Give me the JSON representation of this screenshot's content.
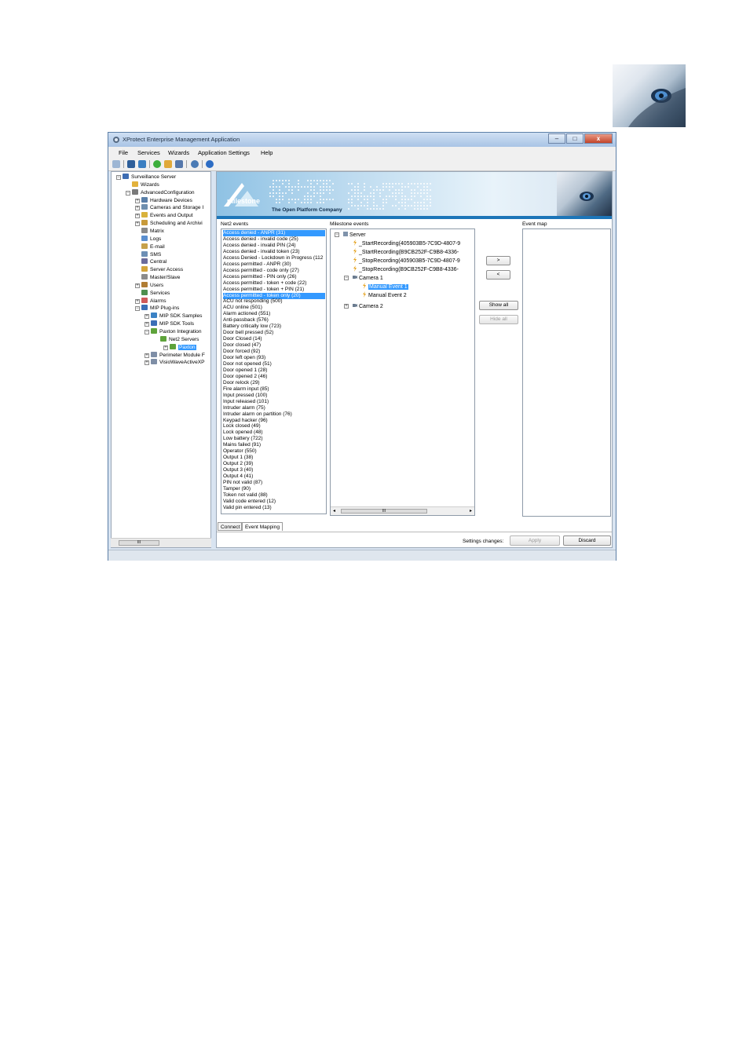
{
  "window": {
    "title": "XProtect Enterprise Management Application",
    "minimize": "–",
    "maximize": "□",
    "close": "x"
  },
  "menu": [
    "File",
    "Services",
    "Wizards",
    "Application Settings",
    "Help"
  ],
  "tree": [
    {
      "label": "Surveillance Server",
      "level": 0
    },
    {
      "label": "Wizards",
      "level": 1
    },
    {
      "label": "AdvancedConfiguration",
      "level": 1
    },
    {
      "label": "Hardware Devices",
      "level": 2
    },
    {
      "label": "Cameras and Storage I",
      "level": 2
    },
    {
      "label": "Events and Output",
      "level": 2
    },
    {
      "label": "Scheduling and Archivi",
      "level": 2
    },
    {
      "label": "Matrix",
      "level": 2
    },
    {
      "label": "Logs",
      "level": 2
    },
    {
      "label": "E-mail",
      "level": 2
    },
    {
      "label": "SMS",
      "level": 2
    },
    {
      "label": "Central",
      "level": 2
    },
    {
      "label": "Server Access",
      "level": 2
    },
    {
      "label": "Master/Slave",
      "level": 2
    },
    {
      "label": "Users",
      "level": 2
    },
    {
      "label": "Services",
      "level": 2
    },
    {
      "label": "Alarms",
      "level": 2
    },
    {
      "label": "MIP Plug-ins",
      "level": 2
    },
    {
      "label": "MIP SDK Samples",
      "level": 3
    },
    {
      "label": "MIP SDK Tools",
      "level": 3
    },
    {
      "label": "Paxton Integration",
      "level": 3
    },
    {
      "label": "Net2 Servers",
      "level": 4
    },
    {
      "label": "Paxton",
      "level": 5
    },
    {
      "label": "Perimeter Module F",
      "level": 3
    },
    {
      "label": "VisioWaveActiveXP",
      "level": 3
    }
  ],
  "tree_scroll_thumb": "III",
  "banner": {
    "brand": "milestone",
    "tagline": "The Open Platform Company"
  },
  "net2_events": {
    "label": "Net2 events",
    "items": [
      "Access denied - ANPR (31)",
      "Access denied - invalid code (25)",
      "Access denied - invalid PIN (24)",
      "Access denied - invalid token (23)",
      "Access Denied - Lockdown in Progress (112",
      "Access permitted - ANPR (30)",
      "Access permitted - code only (27)",
      "Access permitted - PIN only (26)",
      "Access permitted - token + code (22)",
      "Access permitted - token + PIN (21)",
      "Access permitted - token only (20)",
      "ACU not responding (500)",
      "ACU online (501)",
      "Alarm actioned (551)",
      "Anti-passback (576)",
      "Battery critically low (723)",
      "Door bell pressed (52)",
      "Door Closed (14)",
      "Door closed (47)",
      "Door forced (92)",
      "Door left open (93)",
      "Door not opened (51)",
      "Door opened 1 (28)",
      "Door opened 2 (46)",
      "Door relock (29)",
      "Fire alarm input (85)",
      "Input pressed (100)",
      "Input released (101)",
      "Intruder alarm (75)",
      "Intruder alarm on partition (76)",
      "Keypad hacker (96)",
      "Lock closed (49)",
      "Lock opened (48)",
      "Low battery (722)",
      "Mains failed (91)",
      "Operator (550)",
      "Output 1 (38)",
      "Output 2 (39)",
      "Output 3 (40)",
      "Output 4 (41)",
      "PIN not valid (87)",
      "Tamper (90)",
      "Token not valid (88)",
      "Valid code entered (12)",
      "Valid pin entered (13)"
    ],
    "selected": [
      0,
      10
    ]
  },
  "milestone_events": {
    "label": "Milestone events",
    "rows": [
      {
        "label": "Server",
        "level": 0,
        "kind": "server"
      },
      {
        "label": "_StartRecording(405903B5-7C9D-4807-9",
        "level": 1,
        "kind": "event"
      },
      {
        "label": "_StartRecording(B9CB252F-C9B8-4336-",
        "level": 1,
        "kind": "event"
      },
      {
        "label": "_StopRecording(405903B5-7C9D-4807-9",
        "level": 1,
        "kind": "event"
      },
      {
        "label": "_StopRecording(B9CB252F-C9B8-4336-",
        "level": 1,
        "kind": "event"
      },
      {
        "label": "Camera 1",
        "level": 1,
        "kind": "camera"
      },
      {
        "label": "Manual Event 1",
        "level": 2,
        "kind": "event",
        "selected": true
      },
      {
        "label": "Manual Event 2",
        "level": 2,
        "kind": "event"
      },
      {
        "label": "Camera 2",
        "level": 1,
        "kind": "camera"
      }
    ],
    "scroll_thumb": "III"
  },
  "buttons": {
    "add": ">",
    "remove": "<",
    "show_all": "Show all",
    "hide_all": "Hide all",
    "apply": "Apply",
    "discard": "Discard"
  },
  "event_map": {
    "label": "Event map"
  },
  "tabs": [
    "Connect",
    "Event Mapping"
  ],
  "settings_changes": "Settings changes:"
}
